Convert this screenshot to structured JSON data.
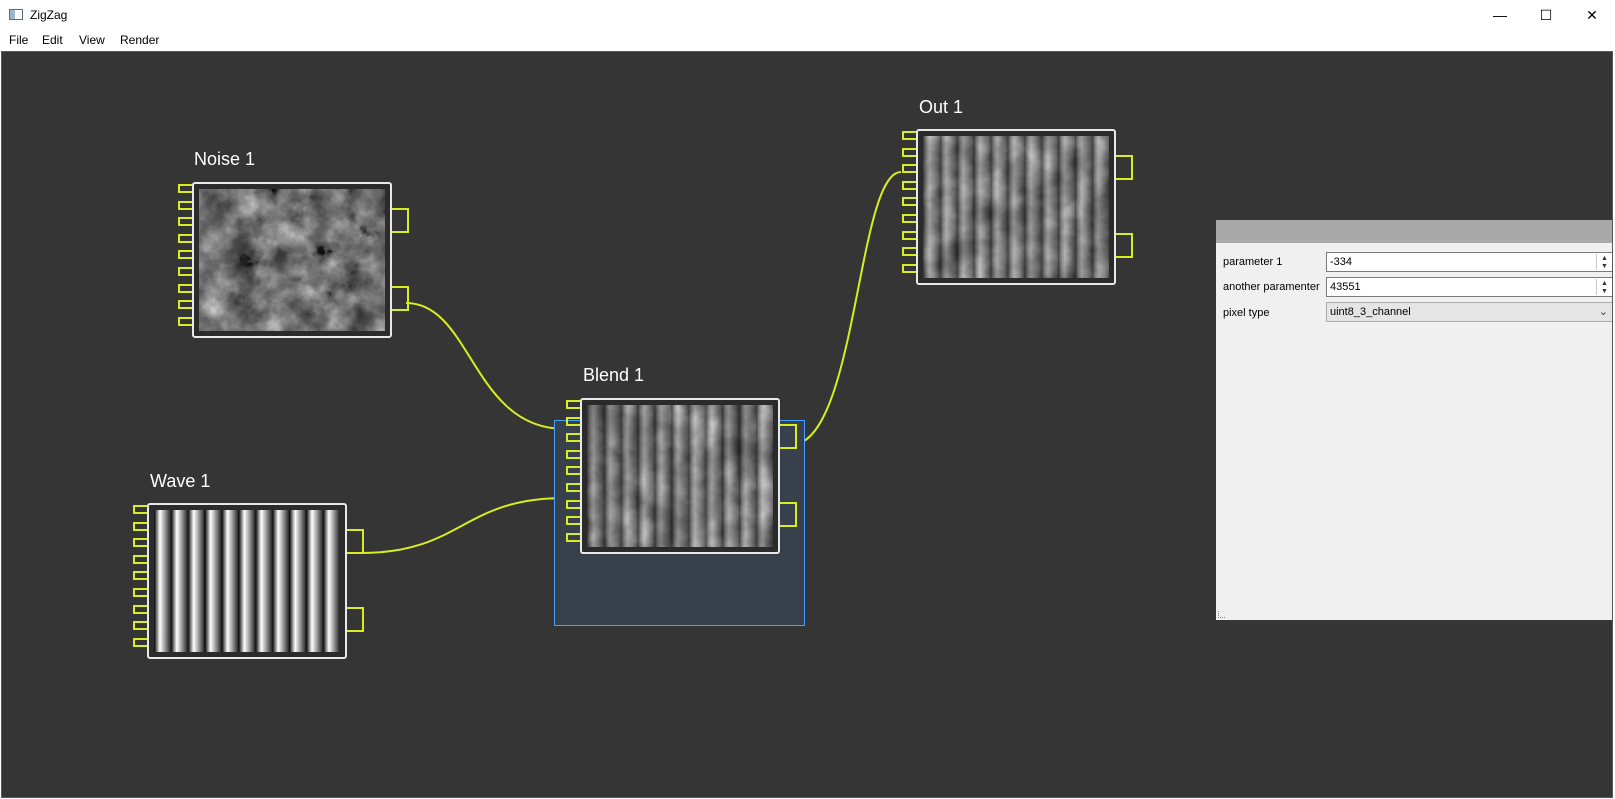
{
  "window": {
    "title": "ZigZag",
    "minimize_glyph": "—",
    "maximize_glyph": "☐",
    "close_glyph": "✕"
  },
  "menu": [
    "File",
    "Edit",
    "View",
    "Render"
  ],
  "nodes": {
    "noise": {
      "title": "Noise 1",
      "preview": "noise"
    },
    "blend": {
      "title": "Blend 1",
      "preview": "blend",
      "selected": true
    },
    "wave": {
      "title": "Wave 1",
      "preview": "stripes"
    },
    "out": {
      "title": "Out 1",
      "preview": "blend"
    }
  },
  "connections": [
    {
      "from": "noise.output2",
      "to": "blend.input2"
    },
    {
      "from": "wave.output1",
      "to": "blend.input7"
    },
    {
      "from": "blend.output1",
      "to": "out.input3"
    }
  ],
  "properties": {
    "param1": {
      "label": "parameter 1",
      "value": "-334"
    },
    "param2": {
      "label": "another paramenter",
      "value": "43551"
    },
    "pixel_type": {
      "label": "pixel type",
      "value": "uint8_3_channel"
    }
  },
  "colors": {
    "canvas": "#353535",
    "port": "#d8ec22",
    "wire": "#d8ec22",
    "selection": "#3fa0ff",
    "node_border": "#e8e8e8"
  }
}
